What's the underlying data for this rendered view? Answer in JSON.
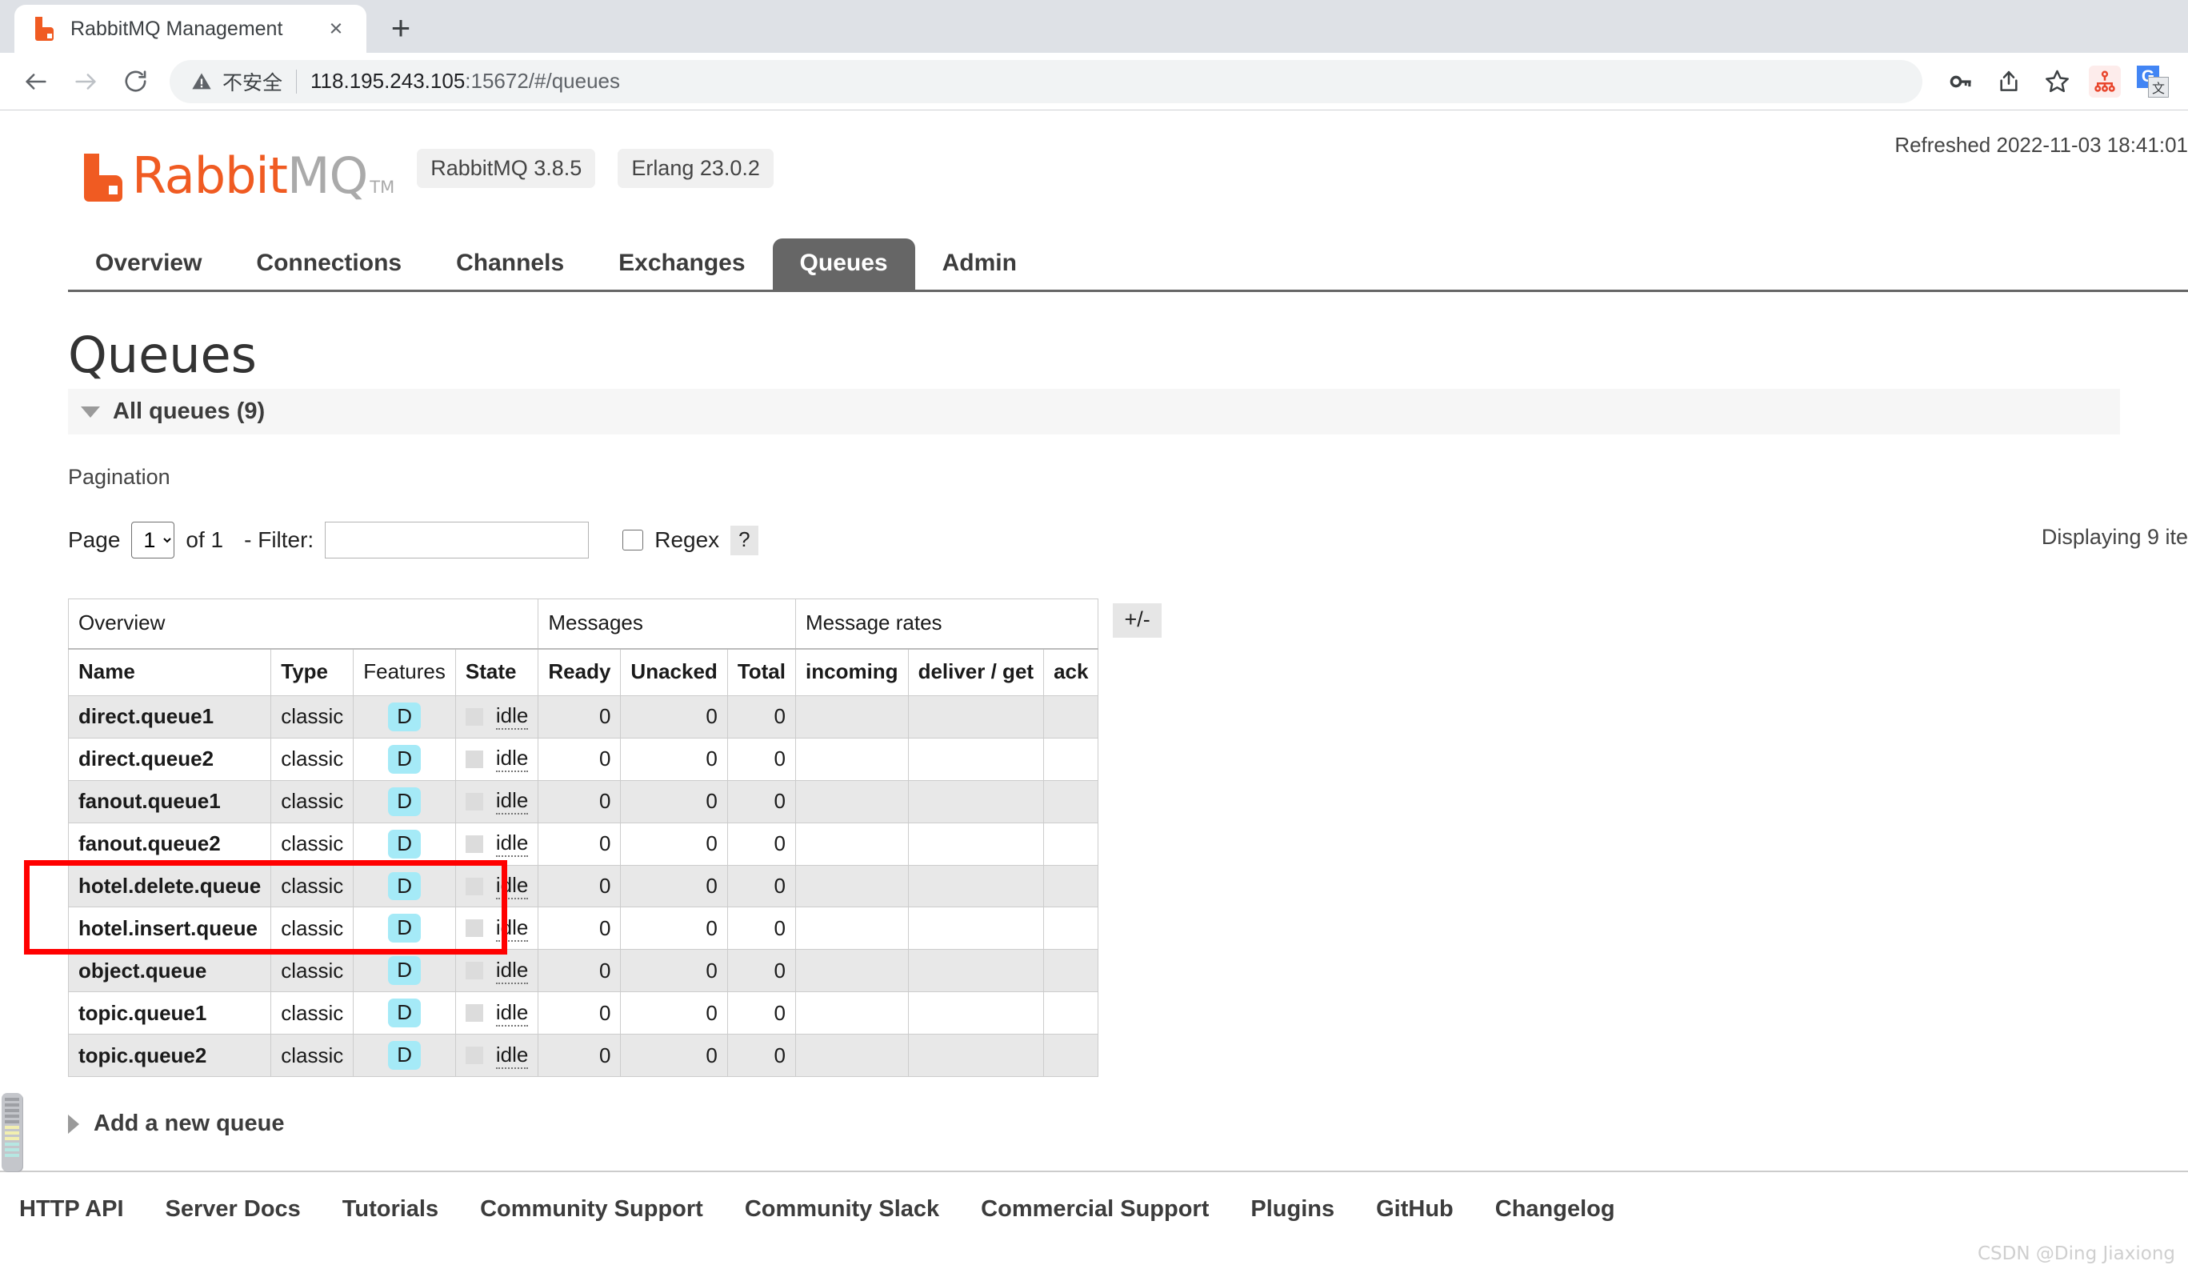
{
  "browser": {
    "tab": {
      "title": "RabbitMQ Management",
      "favicon": "rabbitmq-favicon",
      "close": "×"
    },
    "new_tab": "+",
    "back_icon": "back-arrow-icon",
    "forward_icon": "forward-arrow-icon",
    "reload_icon": "reload-icon",
    "security": {
      "warning_icon": "warning-triangle-icon",
      "label": "不安全"
    },
    "url": {
      "full": "118.195.243.105:15672/#/queues",
      "host": "118.195.243.105",
      "rest": ":15672/#/queues"
    },
    "toolbar_icons": [
      "key-icon",
      "share-icon",
      "star-icon",
      "sitemap-extension-icon",
      "google-translate-icon"
    ],
    "translate": {
      "g": "G",
      "cn": "文"
    }
  },
  "header": {
    "refreshed": "Refreshed 2022-11-03 18:41:01",
    "logo": {
      "rabbit": "Rabbit",
      "mq": "MQ",
      "tm": "TM",
      "mark": "rabbitmq-logo-mark"
    },
    "badges": [
      "RabbitMQ 3.8.5",
      "Erlang 23.0.2"
    ]
  },
  "nav": {
    "tabs": [
      {
        "label": "Overview",
        "active": false
      },
      {
        "label": "Connections",
        "active": false
      },
      {
        "label": "Channels",
        "active": false
      },
      {
        "label": "Exchanges",
        "active": false
      },
      {
        "label": "Queues",
        "active": true
      },
      {
        "label": "Admin",
        "active": false
      }
    ]
  },
  "main": {
    "title": "Queues",
    "all_queues": "All queues (9)",
    "pagination_label": "Pagination",
    "page_label": "Page",
    "page_value": "1",
    "page_options": [
      "1"
    ],
    "of_label": "of 1",
    "filter_label": "- Filter:",
    "filter_value": "",
    "filter_placeholder": "",
    "regex_label": "Regex",
    "regex_help": "?",
    "regex_checked": false,
    "displaying": "Displaying 9 ite",
    "plus_minus": "+/-",
    "add_queue": "Add a new queue"
  },
  "table": {
    "group_headers": [
      {
        "label": "Overview",
        "span": 4
      },
      {
        "label": "Messages",
        "span": 3
      },
      {
        "label": "Message rates",
        "span": 3
      }
    ],
    "columns": [
      {
        "label": "Name",
        "bold": true
      },
      {
        "label": "Type",
        "bold": true
      },
      {
        "label": "Features",
        "bold": false
      },
      {
        "label": "State",
        "bold": true
      },
      {
        "label": "Ready",
        "bold": true
      },
      {
        "label": "Unacked",
        "bold": true
      },
      {
        "label": "Total",
        "bold": true
      },
      {
        "label": "incoming",
        "bold": true
      },
      {
        "label": "deliver / get",
        "bold": true
      },
      {
        "label": "ack",
        "bold": true
      }
    ],
    "rows": [
      {
        "name": "direct.queue1",
        "type": "classic",
        "features": "D",
        "state": "idle",
        "ready": "0",
        "unacked": "0",
        "total": "0",
        "incoming": "",
        "deliver_get": "",
        "ack": "",
        "highlighted": false
      },
      {
        "name": "direct.queue2",
        "type": "classic",
        "features": "D",
        "state": "idle",
        "ready": "0",
        "unacked": "0",
        "total": "0",
        "incoming": "",
        "deliver_get": "",
        "ack": "",
        "highlighted": false
      },
      {
        "name": "fanout.queue1",
        "type": "classic",
        "features": "D",
        "state": "idle",
        "ready": "0",
        "unacked": "0",
        "total": "0",
        "incoming": "",
        "deliver_get": "",
        "ack": "",
        "highlighted": false
      },
      {
        "name": "fanout.queue2",
        "type": "classic",
        "features": "D",
        "state": "idle",
        "ready": "0",
        "unacked": "0",
        "total": "0",
        "incoming": "",
        "deliver_get": "",
        "ack": "",
        "highlighted": false
      },
      {
        "name": "hotel.delete.queue",
        "type": "classic",
        "features": "D",
        "state": "idle",
        "ready": "0",
        "unacked": "0",
        "total": "0",
        "incoming": "",
        "deliver_get": "",
        "ack": "",
        "highlighted": true
      },
      {
        "name": "hotel.insert.queue",
        "type": "classic",
        "features": "D",
        "state": "idle",
        "ready": "0",
        "unacked": "0",
        "total": "0",
        "incoming": "",
        "deliver_get": "",
        "ack": "",
        "highlighted": true
      },
      {
        "name": "object.queue",
        "type": "classic",
        "features": "D",
        "state": "idle",
        "ready": "0",
        "unacked": "0",
        "total": "0",
        "incoming": "",
        "deliver_get": "",
        "ack": "",
        "highlighted": false
      },
      {
        "name": "topic.queue1",
        "type": "classic",
        "features": "D",
        "state": "idle",
        "ready": "0",
        "unacked": "0",
        "total": "0",
        "incoming": "",
        "deliver_get": "",
        "ack": "",
        "highlighted": false
      },
      {
        "name": "topic.queue2",
        "type": "classic",
        "features": "D",
        "state": "idle",
        "ready": "0",
        "unacked": "0",
        "total": "0",
        "incoming": "",
        "deliver_get": "",
        "ack": "",
        "highlighted": false
      }
    ]
  },
  "footer": {
    "links": [
      "HTTP API",
      "Server Docs",
      "Tutorials",
      "Community Support",
      "Community Slack",
      "Commercial Support",
      "Plugins",
      "GitHub",
      "Changelog"
    ]
  },
  "watermark": "CSDN @Ding Jiaxiong",
  "colors": {
    "brand_orange": "#f05b22",
    "active_tab_bg": "#666666",
    "feature_badge_bg": "#a5eaf7",
    "highlight_red": "#ff0000"
  }
}
